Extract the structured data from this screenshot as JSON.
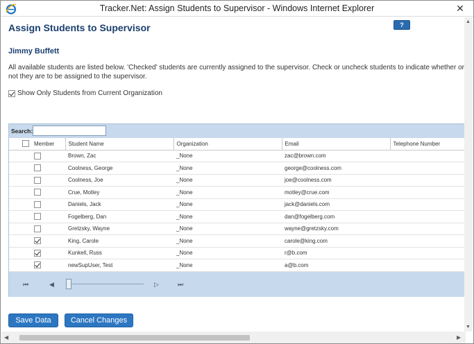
{
  "window": {
    "title": "Tracker.Net: Assign Students to Supervisor - Windows Internet Explorer",
    "close_glyph": "✕"
  },
  "page": {
    "title": "Assign Students to Supervisor",
    "help_label": "?",
    "supervisor_name": "Jimmy Buffett",
    "instructions": "All available students are listed below. 'Checked' students are currently assigned to the supervisor. Check or uncheck students to indicate whether or not they are to be assigned to the supervisor.",
    "show_only_label": "Show Only Students from Current Organization",
    "show_only_checked": true
  },
  "grid": {
    "search_label": "Search:",
    "search_value": "",
    "columns": {
      "member": "Member",
      "student_name": "Student Name",
      "organization": "Organization",
      "email": "Email",
      "telephone": "Telephone Number"
    },
    "rows": [
      {
        "member": false,
        "student_name": "Brown, Zac",
        "organization": "_None",
        "email": "zac@brown.com",
        "telephone": ""
      },
      {
        "member": false,
        "student_name": "Coolness, George",
        "organization": "_None",
        "email": "george@coolness.com",
        "telephone": ""
      },
      {
        "member": false,
        "student_name": "Coolness, Joe",
        "organization": "_None",
        "email": "joe@coolness.com",
        "telephone": ""
      },
      {
        "member": false,
        "student_name": "Crue, Motley",
        "organization": "_None",
        "email": "motley@crue.com",
        "telephone": ""
      },
      {
        "member": false,
        "student_name": "Daniels, Jack",
        "organization": "_None",
        "email": "jack@daniels.com",
        "telephone": ""
      },
      {
        "member": false,
        "student_name": "Fogelberg, Dan",
        "organization": "_None",
        "email": "dan@fogelberg.com",
        "telephone": ""
      },
      {
        "member": false,
        "student_name": "Gretzsky, Wayne",
        "organization": "_None",
        "email": "wayne@gretzsky.com",
        "telephone": ""
      },
      {
        "member": true,
        "student_name": "King, Carole",
        "organization": "_None",
        "email": "carole@king.com",
        "telephone": ""
      },
      {
        "member": true,
        "student_name": "Kunkell, Russ",
        "organization": "_None",
        "email": "r@b.com",
        "telephone": ""
      },
      {
        "member": true,
        "student_name": "newSupUser, Test",
        "organization": "_None",
        "email": "a@b.com",
        "telephone": ""
      }
    ],
    "pager": {
      "first": "⏮",
      "prev": "◀",
      "next": "▷",
      "last": "⏭"
    }
  },
  "buttons": {
    "save_label": "Save Data",
    "cancel_label": "Cancel Changes"
  }
}
